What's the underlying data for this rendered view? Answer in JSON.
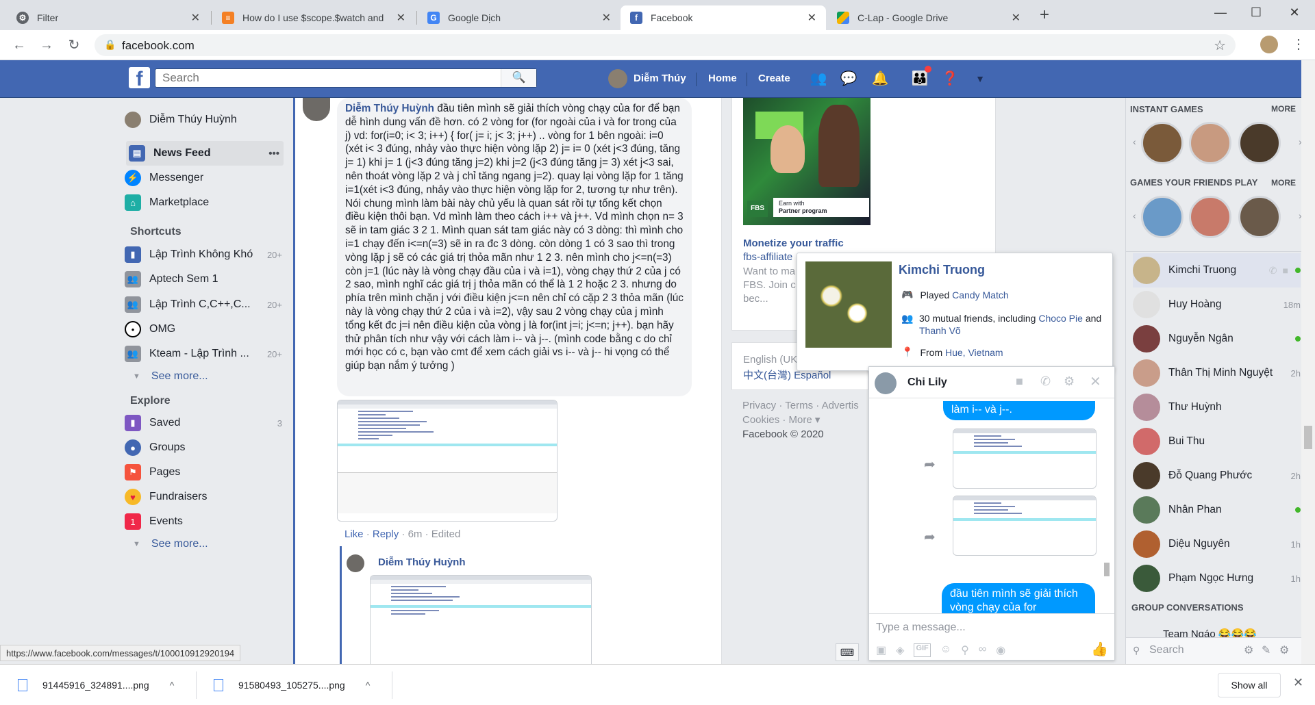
{
  "browser": {
    "tabs": [
      {
        "title": "Filter",
        "close": "✕"
      },
      {
        "title": "How do I use $scope.$watch and",
        "close": "✕"
      },
      {
        "title": "Google Dịch",
        "close": "✕"
      },
      {
        "title": "Facebook",
        "close": "✕"
      },
      {
        "title": "C-Lap - Google Drive",
        "close": "✕"
      }
    ],
    "new_tab": "+",
    "url": "facebook.com",
    "status_url": "https://www.facebook.com/messages/t/100010912920194"
  },
  "header": {
    "search_placeholder": "Search",
    "user_name": "Diễm Thúy",
    "home": "Home",
    "create": "Create"
  },
  "left_nav": {
    "profile": "Diễm Thúy Huỳnh",
    "main_items": [
      {
        "label": "News Feed",
        "dots": "•••"
      },
      {
        "label": "Messenger"
      },
      {
        "label": "Marketplace"
      }
    ],
    "shortcuts_title": "Shortcuts",
    "shortcuts": [
      {
        "label": "Lập Trình Không Khó",
        "count": "20+"
      },
      {
        "label": "Aptech Sem 1",
        "count": ""
      },
      {
        "label": "Lập Trình C,C++,C...",
        "count": "20+"
      },
      {
        "label": "OMG",
        "count": ""
      },
      {
        "label": "Kteam - Lập Trình ...",
        "count": "20+"
      }
    ],
    "see_more": "See more...",
    "explore_title": "Explore",
    "explore": [
      {
        "label": "Saved",
        "count": "3"
      },
      {
        "label": "Groups",
        "count": ""
      },
      {
        "label": "Pages",
        "count": ""
      },
      {
        "label": "Fundraisers",
        "count": ""
      },
      {
        "label": "Events",
        "count": ""
      }
    ],
    "see_more_2": "See more..."
  },
  "comment": {
    "author": "Diễm Thúy Huỳnh",
    "text": "đầu tiên mình sẽ giải thích vòng chạy của for để bạn dễ hình dung vấn đề hơn. có 2 vòng for (for ngoài của i và for trong của j) vd: for(i=0; i< 3; i++) { for( j= i; j< 3; j++) .. vòng for 1 bên ngoài: i=0 (xét i< 3 đúng, nhảy vào thực hiện vòng lặp 2) j= i= 0 (xét j<3 đúng, tăng j= 1) khi j= 1 (j<3 đúng tăng j=2) khi j=2 (j<3 đúng tăng j= 3) xét j<3 sai, nên thoát vòng lặp 2 và j chỉ tăng ngang j=2). quay lại vòng lặp for 1 tăng i=1(xét i<3 đúng, nhảy vào thực hiện vòng lặp for 2, tương tự như trên). Nói chung mình làm bài này chủ yếu là quan sát rồi tự tổng kết chọn điều kiện thôi bạn. Vd mình làm theo cách i++ và j++. Vd mình chọn n= 3 sẽ in tam giác 3 2 1. Mình quan sát tam giác này có 3 dòng: thì mình cho i=1 chạy đến i<=n(=3) sẽ in ra đc 3 dòng. còn dòng 1 có 3 sao thì trong vòng lặp j sẽ có các giá trị thỏa mãn như 1 2 3. nên mình cho j<=n(=3) còn j=1 (lúc này là vòng chạy đầu của i và i=1), vòng chạy thứ 2 của j có 2 sao, mình nghĩ các giá trị j thỏa mãn có thể là 1 2 hoặc 2 3. nhưng do phía trên mình chặn j với điều kiện j<=n nên chỉ có cặp 2 3 thỏa mãn (lúc này là vòng chạy thứ 2 của i và i=2), vậy sau 2 vòng chạy của j mình tổng kết đc j=i nên điều kiện của vòng j là for(int j=i; j<=n; j++). bạn hãy thử phân tích như vậy với cách làm i-- và j--. (mình code bằng c do chỉ mới học có c, bạn vào cmt để xem cách giải vs i-- và j-- hi vọng có thể giúp bạn nắm ý tưởng )",
    "like": "Like",
    "reply": "Reply",
    "time": "6m",
    "edited": "Edited",
    "reply_author": "Diễm Thúy Huỳnh"
  },
  "ad": {
    "image_caption_1": "Earn with",
    "image_caption_2": "Partner program",
    "badge": "FBS",
    "title": "Monetize your traffic",
    "domain": "fbs-affiliate",
    "desc": "Want to ma FBS. Join c bec..."
  },
  "footer": {
    "langs": "English (UK)",
    "langs2": "中文(台灣)  Español",
    "links": "Privacy · Terms · Advertis",
    "links2": "Cookies · More ▾",
    "copyright": "Facebook © 2020"
  },
  "hovercard": {
    "name": "Kimchi Truong",
    "played_prefix": "Played",
    "played_game": "Candy Match",
    "mutual": "30 mutual friends, including",
    "mutual_1": "Choco Pie",
    "mutual_and": "and",
    "mutual_2": "Thanh Võ",
    "from_prefix": "From",
    "from_city": "Hue, Vietnam"
  },
  "chat": {
    "name": "Chi Lily",
    "msg_top": "làm i-- và j--.",
    "msg_bottom": "đầu tiên mình sẽ giải thích vòng chạy của for",
    "input_placeholder": "Type a message..."
  },
  "sidebar": {
    "instant_games": "INSTANT GAMES",
    "more": "MORE",
    "friends_play": "GAMES YOUR FRIENDS PLAY",
    "more2": "MORE",
    "contacts": [
      {
        "name": "Kimchi Truong",
        "time": "",
        "online": true,
        "color": "#c7b48a"
      },
      {
        "name": "Huy Hoàng",
        "time": "18m",
        "online": false,
        "color": "#e0e0e0"
      },
      {
        "name": "Nguyễn Ngân",
        "time": "",
        "online": true,
        "color": "#7a3f3f"
      },
      {
        "name": "Thân Thị Minh Nguyệt",
        "time": "2h",
        "online": false,
        "color": "#c99d8a"
      },
      {
        "name": "Thư Huỳnh",
        "time": "",
        "online": false,
        "color": "#b58d9a"
      },
      {
        "name": "Bui Thu",
        "time": "",
        "online": false,
        "color": "#d16a6a"
      },
      {
        "name": "Đỗ Quang Phước",
        "time": "2h",
        "online": false,
        "color": "#4a3a2a"
      },
      {
        "name": "Nhân Phan",
        "time": "",
        "online": true,
        "color": "#5a7a5a"
      },
      {
        "name": "Diệu Nguyên",
        "time": "1h",
        "online": false,
        "color": "#b06030"
      },
      {
        "name": "Phạm Ngọc Hưng",
        "time": "1h",
        "online": false,
        "color": "#3a5a3a"
      }
    ],
    "group_conversations": "GROUP CONVERSATIONS",
    "group_name": "Team Ngáo 😂😂😂",
    "search_placeholder": "Search"
  },
  "downloads": {
    "file1": "91445916_324891....png",
    "file2": "91580493_105275....png",
    "show_all": "Show all"
  }
}
